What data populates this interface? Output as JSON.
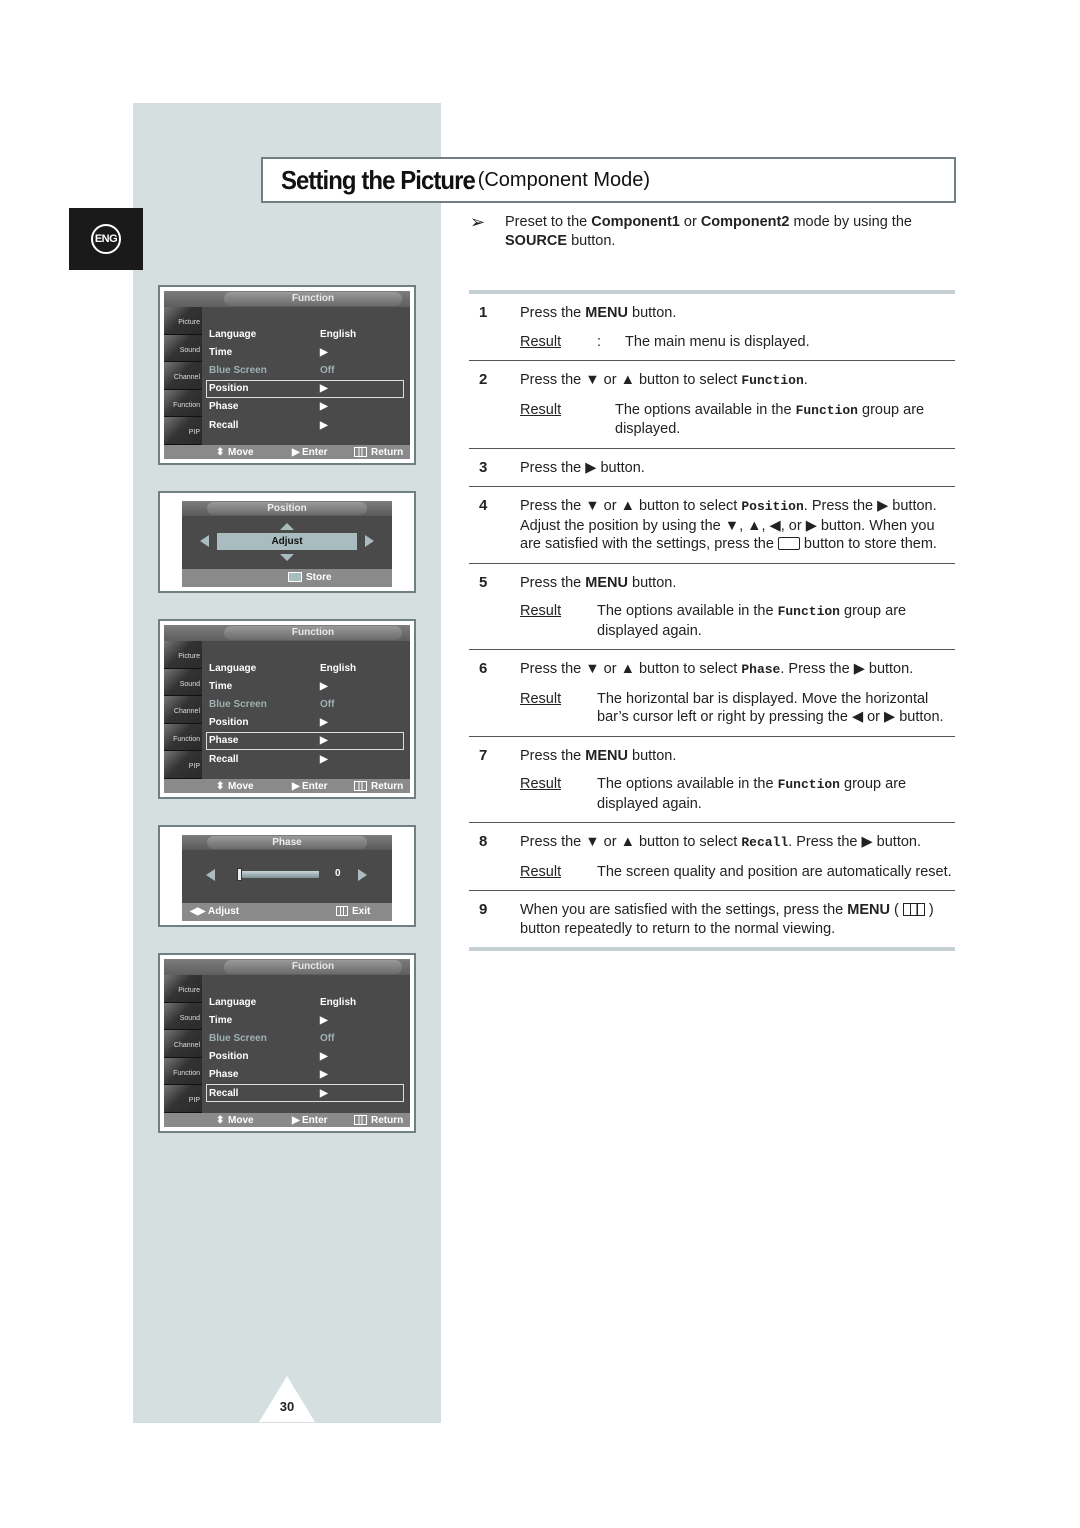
{
  "language_tab": "ENG",
  "title": {
    "main": "Setting the Picture",
    "sub": "(Component Mode)"
  },
  "preset_note": {
    "icon": "arrow-pointer-icon",
    "parts": [
      "Preset to the ",
      "Component1",
      " or ",
      "Component2",
      " mode by using the ",
      "SOURCE",
      " button."
    ]
  },
  "result_label": "Result",
  "steps": [
    {
      "num": "1",
      "text_parts": [
        "Press the ",
        "MENU",
        " button."
      ],
      "result": "The main menu is displayed."
    },
    {
      "num": "2",
      "text_parts": [
        "Press the ▼ or ▲ button to select ",
        "Function",
        "."
      ],
      "result_parts": [
        "The options available in the ",
        "Function",
        " group are displayed."
      ]
    },
    {
      "num": "3",
      "text": "Press the ▶ button."
    },
    {
      "num": "4",
      "text_parts": [
        "Press the ▼ or ▲ button to select ",
        "Position",
        ". Press the ▶ button. Adjust the position by using the ▼, ▲, ◀, or ▶ button. When you are satisfied with the settings, press the ",
        " button to store them."
      ]
    },
    {
      "num": "5",
      "text_parts": [
        "Press the ",
        "MENU",
        " button."
      ],
      "result_parts": [
        "The options available in the ",
        "Function",
        " group are displayed again."
      ]
    },
    {
      "num": "6",
      "text_parts": [
        "Press the ▼ or ▲ button to select ",
        "Phase",
        ". Press the ▶ button."
      ],
      "result": "The horizontal bar is displayed. Move the horizontal bar’s cursor left or right by pressing the ◀ or ▶ button."
    },
    {
      "num": "7",
      "text_parts": [
        "Press the ",
        "MENU",
        " button."
      ],
      "result_parts": [
        "The options available in the ",
        "Function",
        " group are displayed again."
      ]
    },
    {
      "num": "8",
      "text_parts": [
        "Press the ▼ or ▲ button to select ",
        "Recall",
        ". Press the ▶ button."
      ],
      "result": "The screen quality and position are automatically reset."
    },
    {
      "num": "9",
      "text_parts": [
        "When you are satisfied with the settings, press the ",
        "MENU",
        " ( ",
        " ) button repeatedly to return to the normal viewing."
      ]
    }
  ],
  "osd_function": {
    "header": "Function",
    "side_items": [
      "Picture",
      "Sound",
      "Channel",
      "Function",
      "PIP"
    ],
    "rows": [
      {
        "label": "Language",
        "value": "English",
        "dim": false
      },
      {
        "label": "Time",
        "value": "▶",
        "dim": false
      },
      {
        "label": "Blue Screen",
        "value": "Off",
        "dim": true
      },
      {
        "label": "Position",
        "value": "▶",
        "dim": false
      },
      {
        "label": "Phase",
        "value": "▶",
        "dim": false
      },
      {
        "label": "Recall",
        "value": "▶",
        "dim": false
      }
    ],
    "footer": {
      "move": "Move",
      "enter": "Enter",
      "return": "Return"
    },
    "selected_per_screen": [
      "Position",
      "Phase",
      "Recall"
    ]
  },
  "osd_position": {
    "header": "Position",
    "center": "Adjust",
    "footer": "Store"
  },
  "osd_phase": {
    "header": "Phase",
    "value": "0",
    "level_fraction": 0.0,
    "footer_left": "Adjust",
    "footer_right": "Exit"
  },
  "page_number": "30"
}
